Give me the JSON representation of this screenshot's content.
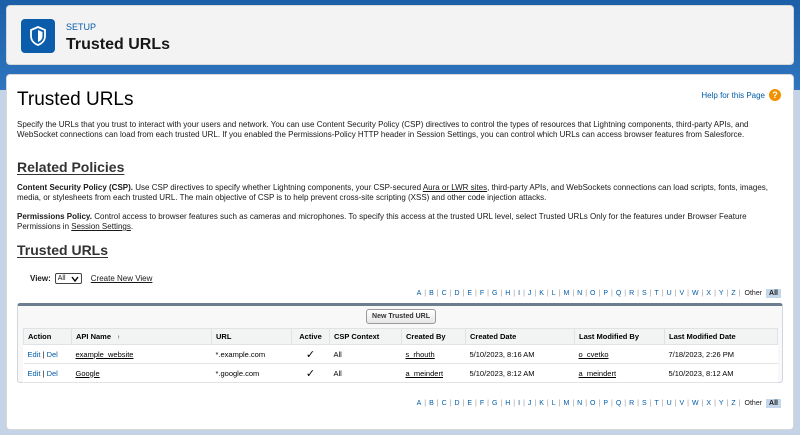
{
  "header": {
    "setup_label": "SETUP",
    "title": "Trusted URLs",
    "icon": "shield-icon"
  },
  "page": {
    "heading": "Trusted URLs",
    "help_link": "Help for this Page",
    "intro": "Specify the URLs that you trust to interact with your users and network. You can use Content Security Policy (CSP) directives to control the types of resources that Lightning components, third-party APIs, and WebSocket connections can load from each trusted URL. If you enabled the Permissions-Policy HTTP header in Session Settings, you can control which URLs can access browser features from Salesforce."
  },
  "related": {
    "heading": "Related Policies",
    "csp_label": "Content Security Policy (CSP).",
    "csp_text_a": " Use CSP directives to specify whether Lightning components, your CSP-secured ",
    "csp_link": "Aura or LWR sites",
    "csp_text_b": ", third-party APIs, and WebSockets connections can load scripts, fonts, images, media, or stylesheets from each trusted URL. The main objective of CSP is to help prevent cross-site scripting (XSS) and other code injection attacks.",
    "perm_label": "Permissions Policy.",
    "perm_text_a": " Control access to browser features such as cameras and microphones. To specify this access at the trusted URL level, select Trusted URLs Only for the features under Browser Feature Permissions in ",
    "perm_link": "Session Settings",
    "perm_text_b": "."
  },
  "list": {
    "heading": "Trusted URLs",
    "view_label": "View:",
    "view_value": "All",
    "create_view": "Create New View",
    "new_button": "New Trusted URL",
    "alpha": [
      "A",
      "B",
      "C",
      "D",
      "E",
      "F",
      "G",
      "H",
      "I",
      "J",
      "K",
      "L",
      "M",
      "N",
      "O",
      "P",
      "Q",
      "R",
      "S",
      "T",
      "U",
      "V",
      "W",
      "X",
      "Y",
      "Z"
    ],
    "other": "Other",
    "all": "All",
    "columns": {
      "action": "Action",
      "api_name": "API Name",
      "sort": "↑",
      "url": "URL",
      "active": "Active",
      "csp": "CSP Context",
      "created_by": "Created By",
      "created_date": "Created Date",
      "modified_by": "Last Modified By",
      "modified_date": "Last Modified Date"
    },
    "edit": "Edit",
    "del": "Del",
    "rows": [
      {
        "api_name": "example_website",
        "url": "*.example.com",
        "active": "✓",
        "csp": "All",
        "created_by": "s_rhouth",
        "created_date": "5/10/2023, 8:16 AM",
        "modified_by": "o_cvetko",
        "modified_date": "7/18/2023, 2:26 PM"
      },
      {
        "api_name": "Google",
        "url": "*.google.com",
        "active": "✓",
        "csp": "All",
        "created_by": "a_meindert",
        "created_date": "5/10/2023, 8:12 AM",
        "modified_by": "a_meindert",
        "modified_date": "5/10/2023, 8:12 AM"
      }
    ]
  }
}
